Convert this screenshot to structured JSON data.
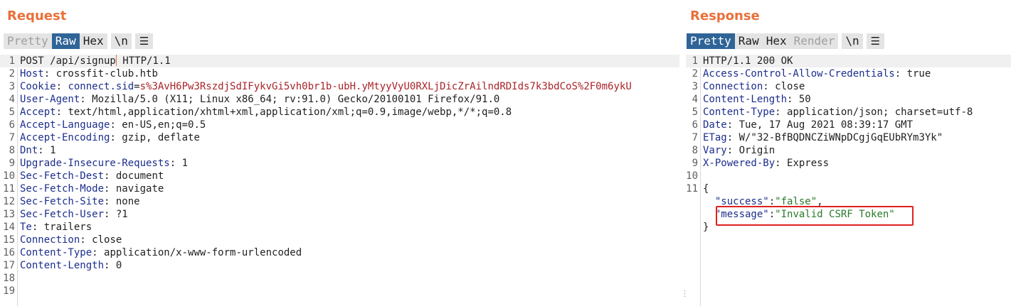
{
  "request": {
    "title": "Request",
    "tabs": [
      "Pretty",
      "Raw",
      "Hex"
    ],
    "newline_btn": "\\n",
    "menu_icon": "hamburger-menu-icon",
    "request_line": {
      "method_path": "POST /api/signup",
      "protocol": " HTTP/1.1"
    },
    "headers": [
      {
        "name": "Host",
        "value": "crossfit-club.htb"
      },
      {
        "name": "Cookie",
        "cookie_name": "connect.sid",
        "cookie_value": "s%3AvH6Pw3RszdjSdIFykvGi5vh0br1b-ubH.yMtyyVyU0RXLjDicZrAilndRDIds7k3bdCoS%2F0m6ykU"
      },
      {
        "name": "User-Agent",
        "value": "Mozilla/5.0 (X11; Linux x86_64; rv:91.0) Gecko/20100101 Firefox/91.0"
      },
      {
        "name": "Accept",
        "value": "text/html,application/xhtml+xml,application/xml;q=0.9,image/webp,*/*;q=0.8"
      },
      {
        "name": "Accept-Language",
        "value": "en-US,en;q=0.5"
      },
      {
        "name": "Accept-Encoding",
        "value": "gzip, deflate"
      },
      {
        "name": "Dnt",
        "value": "1"
      },
      {
        "name": "Upgrade-Insecure-Requests",
        "value": "1"
      },
      {
        "name": "Sec-Fetch-Dest",
        "value": "document"
      },
      {
        "name": "Sec-Fetch-Mode",
        "value": "navigate"
      },
      {
        "name": "Sec-Fetch-Site",
        "value": "none"
      },
      {
        "name": "Sec-Fetch-User",
        "value": "?1"
      },
      {
        "name": "Te",
        "value": "trailers"
      },
      {
        "name": "Connection",
        "value": "close"
      },
      {
        "name": "Content-Type",
        "value": "application/x-www-form-urlencoded"
      },
      {
        "name": "Content-Length",
        "value": "0"
      }
    ],
    "line_numbers": [
      "1",
      "2",
      "3",
      "4",
      "5",
      "6",
      "7",
      "8",
      "9",
      "10",
      "11",
      "12",
      "13",
      "14",
      "15",
      "16",
      "17",
      "18",
      "19"
    ]
  },
  "response": {
    "title": "Response",
    "tabs": [
      "Pretty",
      "Raw",
      "Hex",
      "Render"
    ],
    "newline_btn": "\\n",
    "menu_icon": "hamburger-menu-icon",
    "status_line": "HTTP/1.1 200 OK",
    "headers": [
      {
        "name": "Access-Control-Allow-Credentials",
        "value": "true"
      },
      {
        "name": "Connection",
        "value": "close"
      },
      {
        "name": "Content-Length",
        "value": "50"
      },
      {
        "name": "Content-Type",
        "value": "application/json; charset=utf-8"
      },
      {
        "name": "Date",
        "value": "Tue, 17 Aug 2021 08:39:17 GMT"
      },
      {
        "name": "ETag",
        "value": "W/\"32-BfBQDNCZiWNpDCgjGqEUbRYm3Yk\""
      },
      {
        "name": "Vary",
        "value": "Origin"
      },
      {
        "name": "X-Powered-By",
        "value": "Express"
      }
    ],
    "body": {
      "open_brace": "{",
      "close_brace": "}",
      "fields": [
        {
          "key": "\"success\"",
          "value": "\"false\"",
          "trailing": ","
        },
        {
          "key": "\"message\"",
          "value": "\"Invalid CSRF Token\"",
          "trailing": ""
        }
      ]
    },
    "line_numbers": [
      "1",
      "2",
      "3",
      "4",
      "5",
      "6",
      "7",
      "8",
      "9",
      "10",
      "11"
    ]
  },
  "colors": {
    "accent": "#e8703a",
    "active_tab": "#2f6497",
    "header_name": "#1c2e8c",
    "cookie_value": "#a8242a",
    "json_string": "#2a7a2a",
    "highlight_box": "#e02020"
  }
}
